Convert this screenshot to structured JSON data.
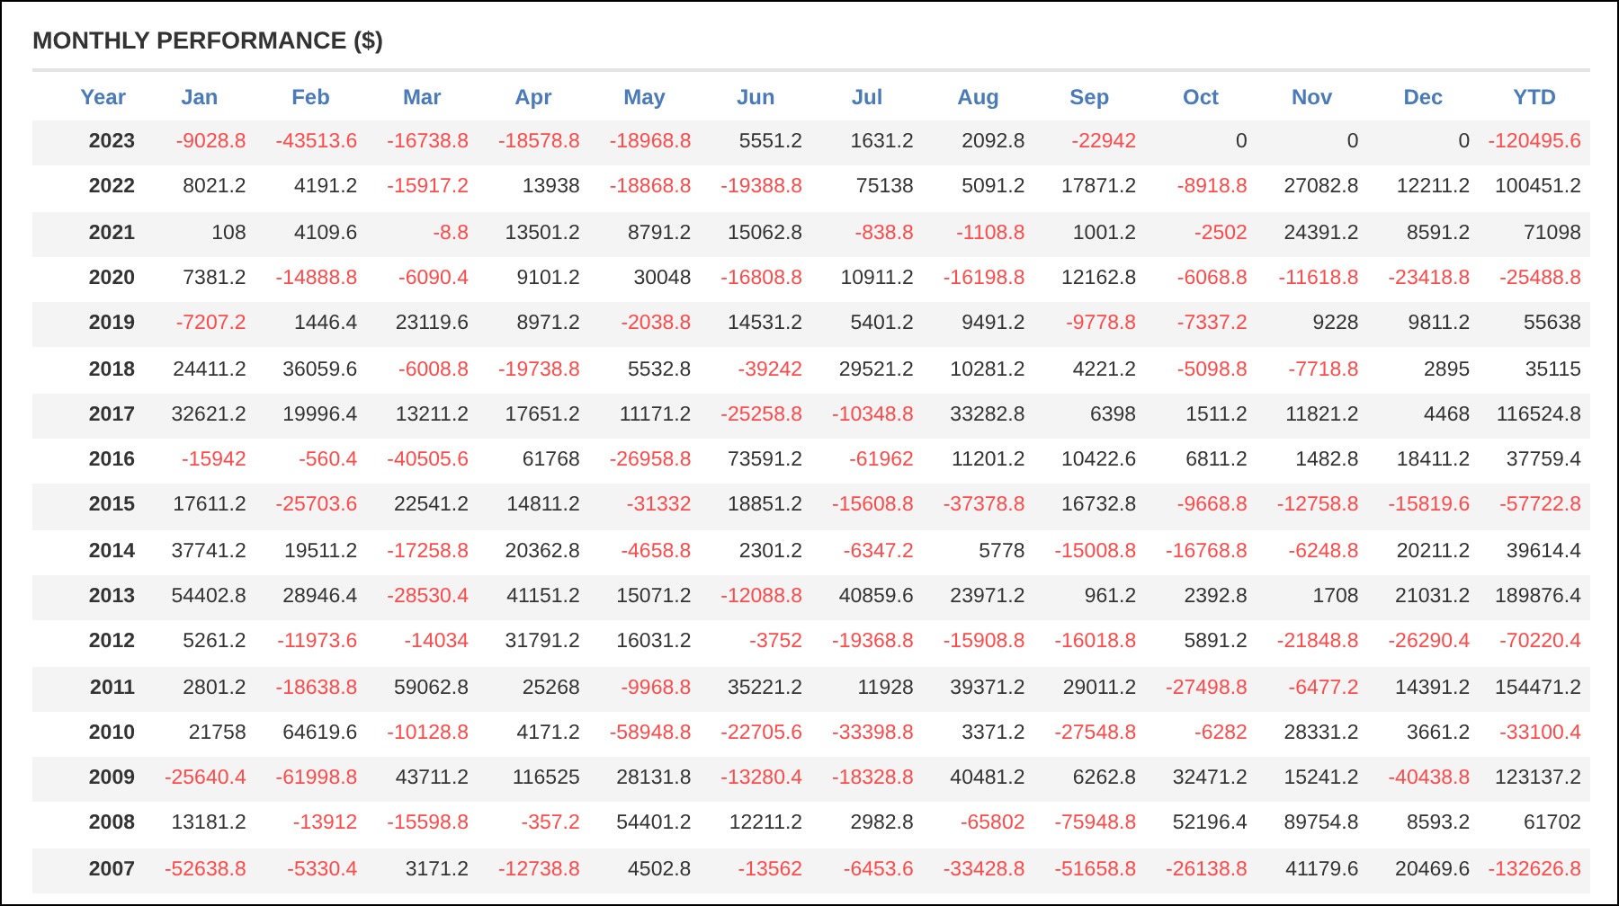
{
  "title": "MONTHLY PERFORMANCE ($)",
  "columns": [
    "Year",
    "Jan",
    "Feb",
    "Mar",
    "Apr",
    "May",
    "Jun",
    "Jul",
    "Aug",
    "Sep",
    "Oct",
    "Nov",
    "Dec",
    "YTD"
  ],
  "rows": [
    {
      "year": "2023",
      "cells": [
        {
          "text": "-9028.8",
          "negative": true
        },
        {
          "text": "-43513.6",
          "negative": true
        },
        {
          "text": "-16738.8",
          "negative": true
        },
        {
          "text": "-18578.8",
          "negative": true
        },
        {
          "text": "-18968.8",
          "negative": true
        },
        {
          "text": "5551.2",
          "negative": false
        },
        {
          "text": "1631.2",
          "negative": false
        },
        {
          "text": "2092.8",
          "negative": false
        },
        {
          "text": "-22942",
          "negative": true
        },
        {
          "text": "0",
          "negative": false
        },
        {
          "text": "0",
          "negative": false
        },
        {
          "text": "0",
          "negative": false
        },
        {
          "text": "-120495.6",
          "negative": true
        }
      ]
    },
    {
      "year": "2022",
      "cells": [
        {
          "text": "8021.2",
          "negative": false
        },
        {
          "text": "4191.2",
          "negative": false
        },
        {
          "text": "-15917.2",
          "negative": true
        },
        {
          "text": "13938",
          "negative": false
        },
        {
          "text": "-18868.8",
          "negative": true
        },
        {
          "text": "-19388.8",
          "negative": true
        },
        {
          "text": "75138",
          "negative": false
        },
        {
          "text": "5091.2",
          "negative": false
        },
        {
          "text": "17871.2",
          "negative": false
        },
        {
          "text": "-8918.8",
          "negative": true
        },
        {
          "text": "27082.8",
          "negative": false
        },
        {
          "text": "12211.2",
          "negative": false
        },
        {
          "text": "100451.2",
          "negative": false
        }
      ]
    },
    {
      "year": "2021",
      "cells": [
        {
          "text": "108",
          "negative": false
        },
        {
          "text": "4109.6",
          "negative": false
        },
        {
          "text": "-8.8",
          "negative": true
        },
        {
          "text": "13501.2",
          "negative": false
        },
        {
          "text": "8791.2",
          "negative": false
        },
        {
          "text": "15062.8",
          "negative": false
        },
        {
          "text": "-838.8",
          "negative": true
        },
        {
          "text": "-1108.8",
          "negative": true
        },
        {
          "text": "1001.2",
          "negative": false
        },
        {
          "text": "-2502",
          "negative": true
        },
        {
          "text": "24391.2",
          "negative": false
        },
        {
          "text": "8591.2",
          "negative": false
        },
        {
          "text": "71098",
          "negative": false
        }
      ]
    },
    {
      "year": "2020",
      "cells": [
        {
          "text": "7381.2",
          "negative": false
        },
        {
          "text": "-14888.8",
          "negative": true
        },
        {
          "text": "-6090.4",
          "negative": true
        },
        {
          "text": "9101.2",
          "negative": false
        },
        {
          "text": "30048",
          "negative": false
        },
        {
          "text": "-16808.8",
          "negative": true
        },
        {
          "text": "10911.2",
          "negative": false
        },
        {
          "text": "-16198.8",
          "negative": true
        },
        {
          "text": "12162.8",
          "negative": false
        },
        {
          "text": "-6068.8",
          "negative": true
        },
        {
          "text": "-11618.8",
          "negative": true
        },
        {
          "text": "-23418.8",
          "negative": true
        },
        {
          "text": "-25488.8",
          "negative": true
        }
      ]
    },
    {
      "year": "2019",
      "cells": [
        {
          "text": "-7207.2",
          "negative": true
        },
        {
          "text": "1446.4",
          "negative": false
        },
        {
          "text": "23119.6",
          "negative": false
        },
        {
          "text": "8971.2",
          "negative": false
        },
        {
          "text": "-2038.8",
          "negative": true
        },
        {
          "text": "14531.2",
          "negative": false
        },
        {
          "text": "5401.2",
          "negative": false
        },
        {
          "text": "9491.2",
          "negative": false
        },
        {
          "text": "-9778.8",
          "negative": true
        },
        {
          "text": "-7337.2",
          "negative": true
        },
        {
          "text": "9228",
          "negative": false
        },
        {
          "text": "9811.2",
          "negative": false
        },
        {
          "text": "55638",
          "negative": false
        }
      ]
    },
    {
      "year": "2018",
      "cells": [
        {
          "text": "24411.2",
          "negative": false
        },
        {
          "text": "36059.6",
          "negative": false
        },
        {
          "text": "-6008.8",
          "negative": true
        },
        {
          "text": "-19738.8",
          "negative": true
        },
        {
          "text": "5532.8",
          "negative": false
        },
        {
          "text": "-39242",
          "negative": true
        },
        {
          "text": "29521.2",
          "negative": false
        },
        {
          "text": "10281.2",
          "negative": false
        },
        {
          "text": "4221.2",
          "negative": false
        },
        {
          "text": "-5098.8",
          "negative": true
        },
        {
          "text": "-7718.8",
          "negative": true
        },
        {
          "text": "2895",
          "negative": false
        },
        {
          "text": "35115",
          "negative": false
        }
      ]
    },
    {
      "year": "2017",
      "cells": [
        {
          "text": "32621.2",
          "negative": false
        },
        {
          "text": "19996.4",
          "negative": false
        },
        {
          "text": "13211.2",
          "negative": false
        },
        {
          "text": "17651.2",
          "negative": false
        },
        {
          "text": "11171.2",
          "negative": false
        },
        {
          "text": "-25258.8",
          "negative": true
        },
        {
          "text": "-10348.8",
          "negative": true
        },
        {
          "text": "33282.8",
          "negative": false
        },
        {
          "text": "6398",
          "negative": false
        },
        {
          "text": "1511.2",
          "negative": false
        },
        {
          "text": "11821.2",
          "negative": false
        },
        {
          "text": "4468",
          "negative": false
        },
        {
          "text": "116524.8",
          "negative": false
        }
      ]
    },
    {
      "year": "2016",
      "cells": [
        {
          "text": "-15942",
          "negative": true
        },
        {
          "text": "-560.4",
          "negative": true
        },
        {
          "text": "-40505.6",
          "negative": true
        },
        {
          "text": "61768",
          "negative": false
        },
        {
          "text": "-26958.8",
          "negative": true
        },
        {
          "text": "73591.2",
          "negative": false
        },
        {
          "text": "-61962",
          "negative": true
        },
        {
          "text": "11201.2",
          "negative": false
        },
        {
          "text": "10422.6",
          "negative": false
        },
        {
          "text": "6811.2",
          "negative": false
        },
        {
          "text": "1482.8",
          "negative": false
        },
        {
          "text": "18411.2",
          "negative": false
        },
        {
          "text": "37759.4",
          "negative": false
        }
      ]
    },
    {
      "year": "2015",
      "cells": [
        {
          "text": "17611.2",
          "negative": false
        },
        {
          "text": "-25703.6",
          "negative": true
        },
        {
          "text": "22541.2",
          "negative": false
        },
        {
          "text": "14811.2",
          "negative": false
        },
        {
          "text": "-31332",
          "negative": true
        },
        {
          "text": "18851.2",
          "negative": false
        },
        {
          "text": "-15608.8",
          "negative": true
        },
        {
          "text": "-37378.8",
          "negative": true
        },
        {
          "text": "16732.8",
          "negative": false
        },
        {
          "text": "-9668.8",
          "negative": true
        },
        {
          "text": "-12758.8",
          "negative": true
        },
        {
          "text": "-15819.6",
          "negative": true
        },
        {
          "text": "-57722.8",
          "negative": true
        }
      ]
    },
    {
      "year": "2014",
      "cells": [
        {
          "text": "37741.2",
          "negative": false
        },
        {
          "text": "19511.2",
          "negative": false
        },
        {
          "text": "-17258.8",
          "negative": true
        },
        {
          "text": "20362.8",
          "negative": false
        },
        {
          "text": "-4658.8",
          "negative": true
        },
        {
          "text": "2301.2",
          "negative": false
        },
        {
          "text": "-6347.2",
          "negative": true
        },
        {
          "text": "5778",
          "negative": false
        },
        {
          "text": "-15008.8",
          "negative": true
        },
        {
          "text": "-16768.8",
          "negative": true
        },
        {
          "text": "-6248.8",
          "negative": true
        },
        {
          "text": "20211.2",
          "negative": false
        },
        {
          "text": "39614.4",
          "negative": false
        }
      ]
    },
    {
      "year": "2013",
      "cells": [
        {
          "text": "54402.8",
          "negative": false
        },
        {
          "text": "28946.4",
          "negative": false
        },
        {
          "text": "-28530.4",
          "negative": true
        },
        {
          "text": "41151.2",
          "negative": false
        },
        {
          "text": "15071.2",
          "negative": false
        },
        {
          "text": "-12088.8",
          "negative": true
        },
        {
          "text": "40859.6",
          "negative": false
        },
        {
          "text": "23971.2",
          "negative": false
        },
        {
          "text": "961.2",
          "negative": false
        },
        {
          "text": "2392.8",
          "negative": false
        },
        {
          "text": "1708",
          "negative": false
        },
        {
          "text": "21031.2",
          "negative": false
        },
        {
          "text": "189876.4",
          "negative": false
        }
      ]
    },
    {
      "year": "2012",
      "cells": [
        {
          "text": "5261.2",
          "negative": false
        },
        {
          "text": "-11973.6",
          "negative": true
        },
        {
          "text": "-14034",
          "negative": true
        },
        {
          "text": "31791.2",
          "negative": false
        },
        {
          "text": "16031.2",
          "negative": false
        },
        {
          "text": "-3752",
          "negative": true
        },
        {
          "text": "-19368.8",
          "negative": true
        },
        {
          "text": "-15908.8",
          "negative": true
        },
        {
          "text": "-16018.8",
          "negative": true
        },
        {
          "text": "5891.2",
          "negative": false
        },
        {
          "text": "-21848.8",
          "negative": true
        },
        {
          "text": "-26290.4",
          "negative": true
        },
        {
          "text": "-70220.4",
          "negative": true
        }
      ]
    },
    {
      "year": "2011",
      "cells": [
        {
          "text": "2801.2",
          "negative": false
        },
        {
          "text": "-18638.8",
          "negative": true
        },
        {
          "text": "59062.8",
          "negative": false
        },
        {
          "text": "25268",
          "negative": false
        },
        {
          "text": "-9968.8",
          "negative": true
        },
        {
          "text": "35221.2",
          "negative": false
        },
        {
          "text": "11928",
          "negative": false
        },
        {
          "text": "39371.2",
          "negative": false
        },
        {
          "text": "29011.2",
          "negative": false
        },
        {
          "text": "-27498.8",
          "negative": true
        },
        {
          "text": "-6477.2",
          "negative": true
        },
        {
          "text": "14391.2",
          "negative": false
        },
        {
          "text": "154471.2",
          "negative": false
        }
      ]
    },
    {
      "year": "2010",
      "cells": [
        {
          "text": "21758",
          "negative": false
        },
        {
          "text": "64619.6",
          "negative": false
        },
        {
          "text": "-10128.8",
          "negative": true
        },
        {
          "text": "4171.2",
          "negative": false
        },
        {
          "text": "-58948.8",
          "negative": true
        },
        {
          "text": "-22705.6",
          "negative": true
        },
        {
          "text": "-33398.8",
          "negative": true
        },
        {
          "text": "3371.2",
          "negative": false
        },
        {
          "text": "-27548.8",
          "negative": true
        },
        {
          "text": "-6282",
          "negative": true
        },
        {
          "text": "28331.2",
          "negative": false
        },
        {
          "text": "3661.2",
          "negative": false
        },
        {
          "text": "-33100.4",
          "negative": true
        }
      ]
    },
    {
      "year": "2009",
      "cells": [
        {
          "text": "-25640.4",
          "negative": true
        },
        {
          "text": "-61998.8",
          "negative": true
        },
        {
          "text": "43711.2",
          "negative": false
        },
        {
          "text": "116525",
          "negative": false
        },
        {
          "text": "28131.8",
          "negative": false
        },
        {
          "text": "-13280.4",
          "negative": true
        },
        {
          "text": "-18328.8",
          "negative": true
        },
        {
          "text": "40481.2",
          "negative": false
        },
        {
          "text": "6262.8",
          "negative": false
        },
        {
          "text": "32471.2",
          "negative": false
        },
        {
          "text": "15241.2",
          "negative": false
        },
        {
          "text": "-40438.8",
          "negative": true
        },
        {
          "text": "123137.2",
          "negative": false
        }
      ]
    },
    {
      "year": "2008",
      "cells": [
        {
          "text": "13181.2",
          "negative": false
        },
        {
          "text": "-13912",
          "negative": true
        },
        {
          "text": "-15598.8",
          "negative": true
        },
        {
          "text": "-357.2",
          "negative": true
        },
        {
          "text": "54401.2",
          "negative": false
        },
        {
          "text": "12211.2",
          "negative": false
        },
        {
          "text": "2982.8",
          "negative": false
        },
        {
          "text": "-65802",
          "negative": true
        },
        {
          "text": "-75948.8",
          "negative": true
        },
        {
          "text": "52196.4",
          "negative": false
        },
        {
          "text": "89754.8",
          "negative": false
        },
        {
          "text": "8593.2",
          "negative": false
        },
        {
          "text": "61702",
          "negative": false
        }
      ]
    },
    {
      "year": "2007",
      "cells": [
        {
          "text": "-52638.8",
          "negative": true
        },
        {
          "text": "-5330.4",
          "negative": true
        },
        {
          "text": "3171.2",
          "negative": false
        },
        {
          "text": "-12738.8",
          "negative": true
        },
        {
          "text": "4502.8",
          "negative": false
        },
        {
          "text": "-13562",
          "negative": true
        },
        {
          "text": "-6453.6",
          "negative": true
        },
        {
          "text": "-33428.8",
          "negative": true
        },
        {
          "text": "-51658.8",
          "negative": true
        },
        {
          "text": "-26138.8",
          "negative": true
        },
        {
          "text": "41179.6",
          "negative": false
        },
        {
          "text": "20469.6",
          "negative": false
        },
        {
          "text": "-132626.8",
          "negative": true
        }
      ]
    }
  ]
}
